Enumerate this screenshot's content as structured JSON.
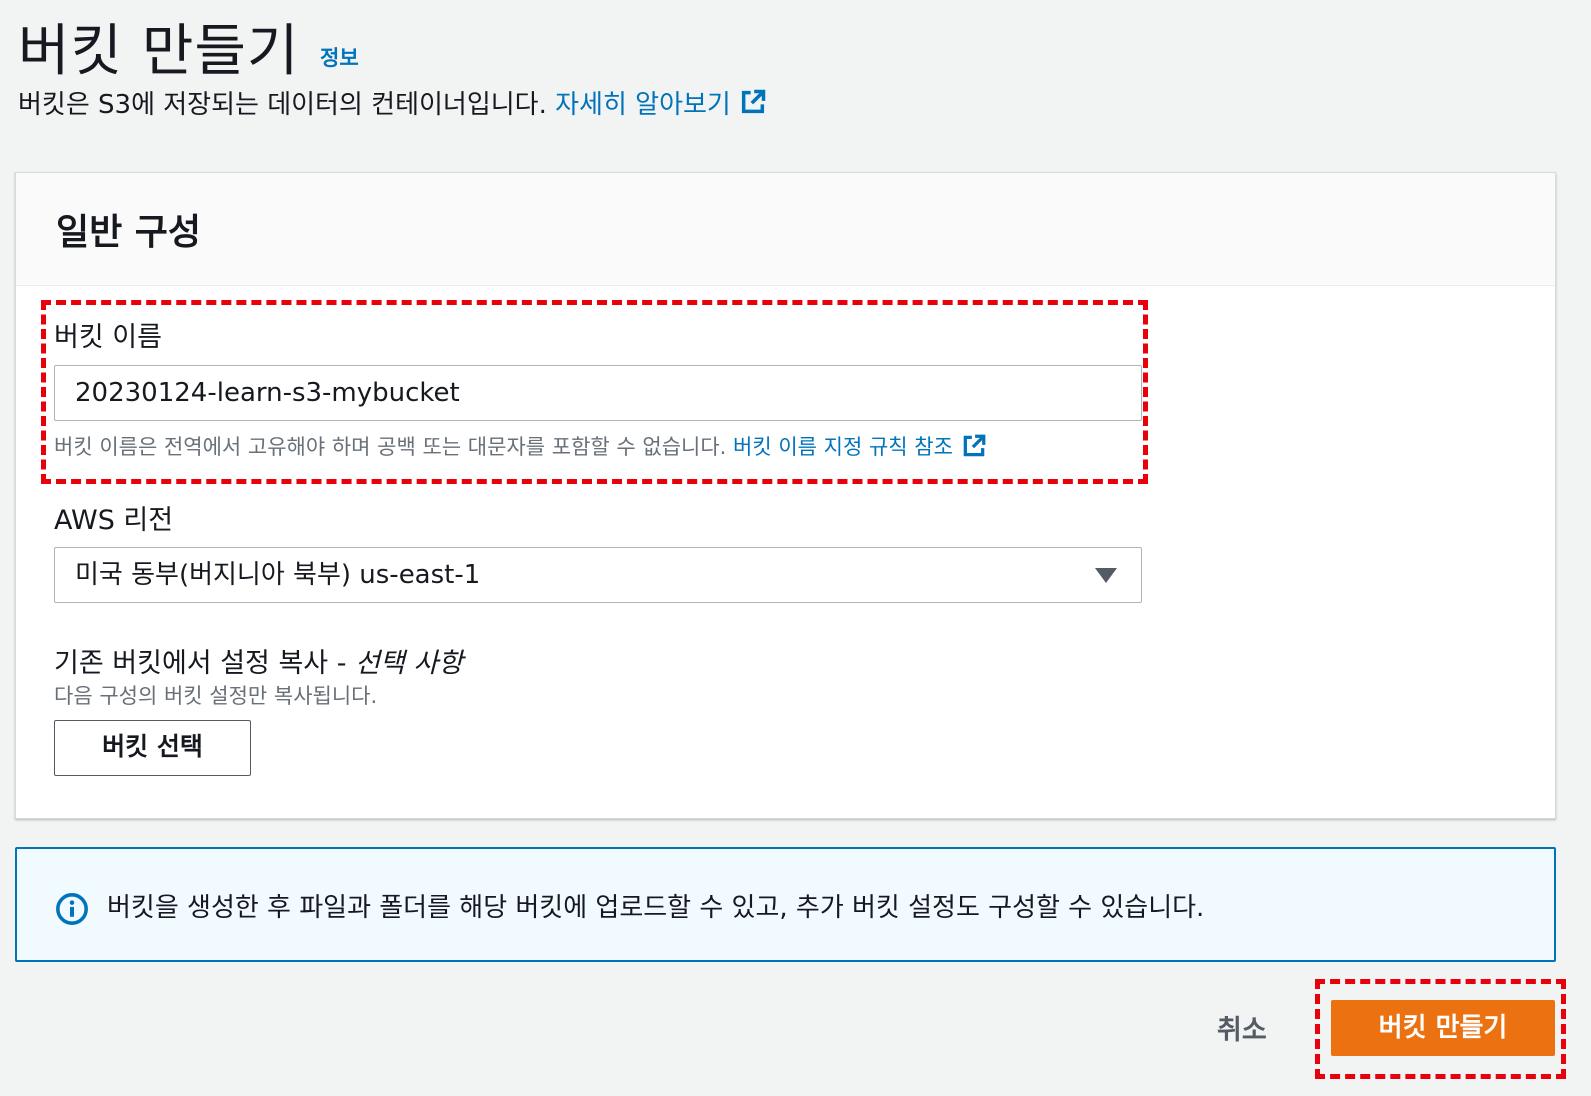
{
  "header": {
    "title": "버킷 만들기",
    "info_link": "정보",
    "subtitle": "버킷은 S3에 저장되는 데이터의 컨테이너입니다.",
    "learn_more": "자세히 알아보기"
  },
  "general_config": {
    "title": "일반 구성",
    "bucket_name": {
      "label": "버킷 이름",
      "value": "20230124-learn-s3-mybucket",
      "description": "버킷 이름은 전역에서 고유해야 하며 공백 또는 대문자를 포함할 수 없습니다.",
      "rules_link": "버킷 이름 지정 규칙 참조"
    },
    "region": {
      "label": "AWS 리전",
      "selected": "미국 동부(버지니아 북부) us-east-1"
    },
    "copy_settings": {
      "label": "기존 버킷에서 설정 복사 -",
      "optional": "선택 사항",
      "description": "다음 구성의 버킷 설정만 복사됩니다.",
      "button": "버킷 선택"
    }
  },
  "info_alert": {
    "text": "버킷을 생성한 후 파일과 폴더를 해당 버킷에 업로드할 수 있고, 추가 버킷 설정도 구성할 수 있습니다."
  },
  "footer": {
    "cancel": "취소",
    "create": "버킷 만들기"
  },
  "colors": {
    "link": "#0073bb",
    "primary_button": "#ec7211",
    "highlight_dashed": "#e8000b",
    "alert_border": "#0073bb"
  }
}
